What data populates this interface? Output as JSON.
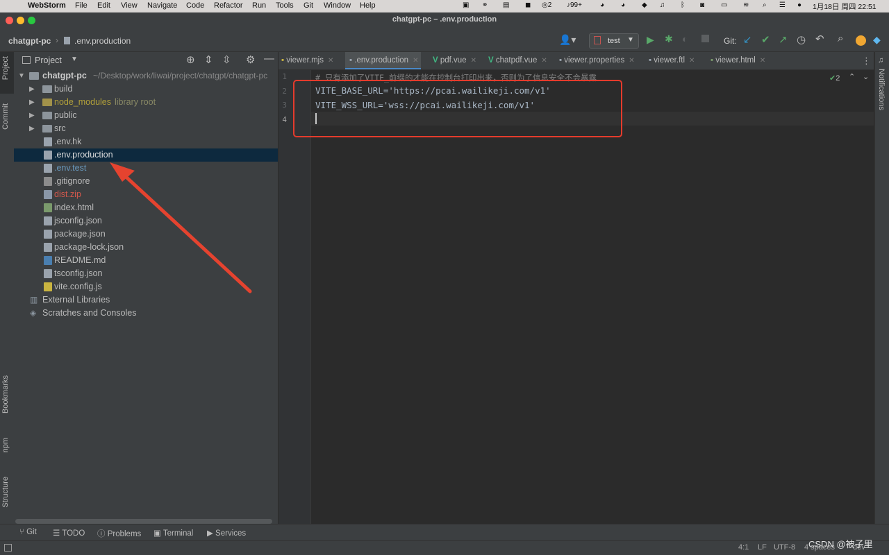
{
  "menubar": {
    "apple": "",
    "app": "WebStorm",
    "items": [
      "File",
      "Edit",
      "View",
      "Navigate",
      "Code",
      "Refactor",
      "Run",
      "Tools",
      "Git",
      "Window",
      "Help"
    ],
    "tray_badge_2": "2",
    "tray_badge_99": "99+",
    "clock": "1月18日 周四 22:51"
  },
  "window": {
    "title": "chatgpt-pc – .env.production"
  },
  "navbar": {
    "project": "chatgpt-pc",
    "separator": "›",
    "file": ".env.production",
    "run_config": "test",
    "git_label": "Git:"
  },
  "left_strip": {
    "project": "Project",
    "commit": "Commit",
    "bookmarks": "Bookmarks",
    "npm": "npm",
    "structure": "Structure"
  },
  "right_strip": {
    "notifications": "Notifications"
  },
  "project_panel": {
    "title": "Project",
    "root_name": "chatgpt-pc",
    "root_path": "~/Desktop/work/liwai/project/chatgpt/chatgpt-pc",
    "items": [
      {
        "name": "build"
      },
      {
        "name": "node_modules",
        "extra": "library root"
      },
      {
        "name": "public"
      },
      {
        "name": "src"
      },
      {
        "name": ".env.hk"
      },
      {
        "name": ".env.production"
      },
      {
        "name": ".env.test"
      },
      {
        "name": ".gitignore"
      },
      {
        "name": "dist.zip"
      },
      {
        "name": "index.html"
      },
      {
        "name": "jsconfig.json"
      },
      {
        "name": "package.json"
      },
      {
        "name": "package-lock.json"
      },
      {
        "name": "README.md"
      },
      {
        "name": "tsconfig.json"
      },
      {
        "name": "vite.config.js"
      }
    ],
    "external_libraries": "External Libraries",
    "scratches": "Scratches and Consoles"
  },
  "tabs": [
    {
      "label": "viewer.mjs"
    },
    {
      "label": ".env.production"
    },
    {
      "label": "pdf.vue"
    },
    {
      "label": "chatpdf.vue"
    },
    {
      "label": "viewer.properties"
    },
    {
      "label": "viewer.ftl"
    },
    {
      "label": "viewer.html"
    }
  ],
  "editor": {
    "line_numbers": [
      "1",
      "2",
      "3",
      "4"
    ],
    "lines": [
      "# 只有添加了VITE_前缀的才能在控制台打印出来，否则为了信息安全不会暴露",
      "VITE_BASE_URL='https://pcai.wailikeji.com/v1'",
      "VITE_WSS_URL='wss://pcai.wailikeji.com/v1'",
      ""
    ],
    "inspection_count": "2"
  },
  "bottom_tabs": [
    "Git",
    "TODO",
    "Problems",
    "Terminal",
    "Services"
  ],
  "status": {
    "position": "4:1",
    "line_sep": "LF",
    "encoding": "UTF-8",
    "indent": "4 spaces",
    "branch": "dev",
    "watermark": "CSDN @被子里"
  },
  "colors": {
    "accent": "#4a88c7",
    "highlight_box": "#e53b2c",
    "arrow": "#e5432f",
    "selection": "#0d293e",
    "library_text": "#b3a13a",
    "ignored_text": "#d2584c",
    "modified_text": "#6897bb"
  }
}
